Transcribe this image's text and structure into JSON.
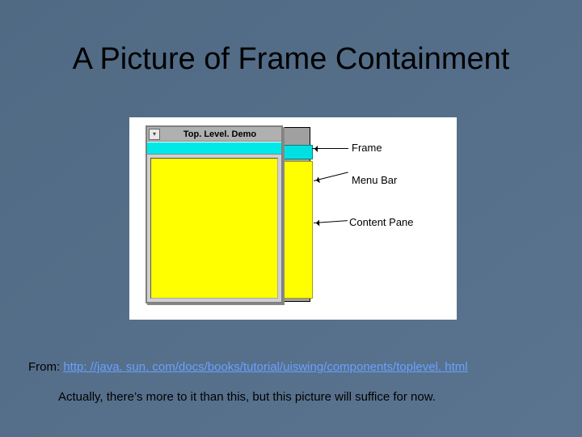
{
  "title": "A Picture of Frame Containment",
  "diagram": {
    "window_title": "Top. Level. Demo",
    "labels": {
      "frame": "Frame",
      "menubar": "Menu Bar",
      "contentpane": "Content Pane"
    }
  },
  "from_prefix": "From:  ",
  "from_url": "http: //java. sun. com/docs/books/tutorial/uiswing/components/toplevel. html",
  "note": "Actually, there’s more to it than this, but this picture will suffice for now."
}
